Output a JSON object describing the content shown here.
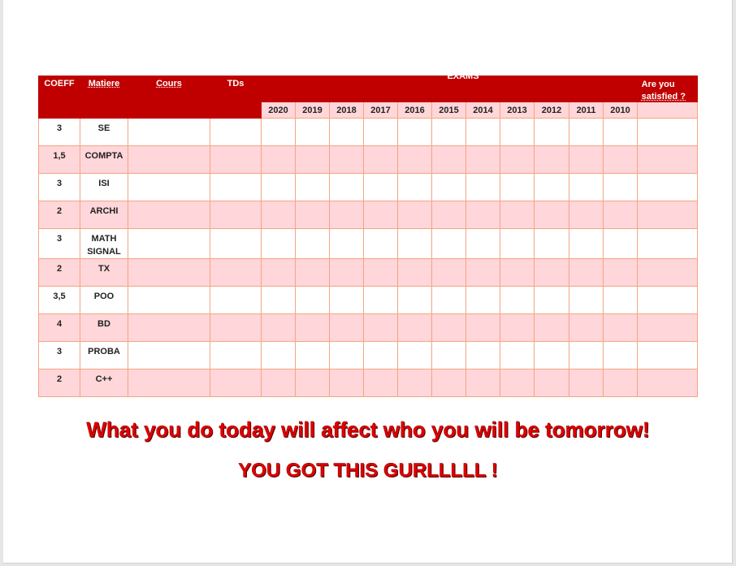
{
  "table": {
    "headers": {
      "coeff": "COEFF",
      "matiere": "Matiere",
      "cours": "Cours",
      "tds": "TDs",
      "exams": "EXAMS",
      "satisfied_line1": "Are you",
      "satisfied_line2": "satisfied ?"
    },
    "years": [
      "2020",
      "2019",
      "2018",
      "2017",
      "2016",
      "2015",
      "2014",
      "2013",
      "2012",
      "2011",
      "2010"
    ],
    "rows": [
      {
        "coeff": "3",
        "matiere": "SE"
      },
      {
        "coeff": "1,5",
        "matiere": "COMPTA"
      },
      {
        "coeff": "3",
        "matiere": "ISI"
      },
      {
        "coeff": "2",
        "matiere": "ARCHI"
      },
      {
        "coeff": "3",
        "matiere": "MATH SIGNAL"
      },
      {
        "coeff": "2",
        "matiere": "TX"
      },
      {
        "coeff": "3,5",
        "matiere": "POO"
      },
      {
        "coeff": "4",
        "matiere": "BD"
      },
      {
        "coeff": "3",
        "matiere": "PROBA"
      },
      {
        "coeff": "2",
        "matiere": "C++"
      }
    ]
  },
  "messages": {
    "line1": "What you do today will affect who you will be tomorrow!",
    "line2": "YOU GOT THIS GURLLLLL !"
  },
  "colors": {
    "header_red": "#c00000",
    "row_pink": "#ffd6d9",
    "border_orange": "#f4a582",
    "text_red": "#e00000"
  }
}
